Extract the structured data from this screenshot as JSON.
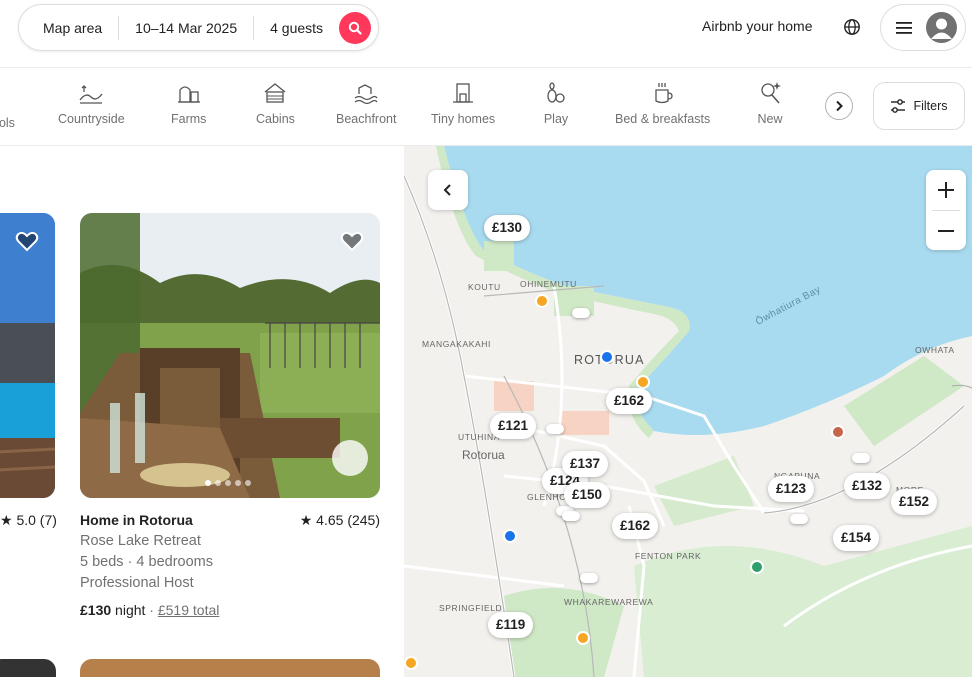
{
  "header": {
    "search": {
      "where": "Map area",
      "dates": "10–14 Mar 2025",
      "guests": "4 guests"
    },
    "host_link": "Airbnb your home",
    "brand_color": "#ff385c"
  },
  "categories": {
    "items": [
      {
        "label": "ools",
        "icon": "pools-icon"
      },
      {
        "label": "Countryside",
        "icon": "countryside-icon"
      },
      {
        "label": "Farms",
        "icon": "farms-icon"
      },
      {
        "label": "Cabins",
        "icon": "cabins-icon"
      },
      {
        "label": "Beachfront",
        "icon": "beachfront-icon"
      },
      {
        "label": "Tiny homes",
        "icon": "tiny-homes-icon"
      },
      {
        "label": "Play",
        "icon": "play-icon"
      },
      {
        "label": "Bed & breakfasts",
        "icon": "bed-breakfast-icon"
      },
      {
        "label": "New",
        "icon": "new-icon"
      }
    ],
    "filters_label": "Filters"
  },
  "listings": {
    "left_rating": "★ 5.0 (7)",
    "main": {
      "title": "Home in Rotorua",
      "rating": "★ 4.65 (245)",
      "name": "Rose Lake Retreat",
      "beds": "5 beds · 4 bedrooms",
      "host": "Professional Host",
      "price": "£130",
      "price_unit": " night",
      "separator": " · ",
      "total": "£519 total"
    }
  },
  "map": {
    "pins": [
      "£130",
      "£162",
      "£121",
      "£137",
      "£124",
      "£150",
      "£162",
      "£123",
      "£132",
      "£152",
      "£154",
      "£119"
    ],
    "labels": {
      "koutu": "KOUTU",
      "ohinemutu": "OHINEMUTU",
      "mangakakahi": "MANGAKAKAHI",
      "rotorua_caps": "ROTORUA",
      "utuhina": "UTUHINA",
      "rotorua": "Rotorua",
      "glenholme": "GLENHO",
      "fenton_park": "FENTON PARK",
      "ngapuna": "NGAPUNA",
      "owhata": "OWHATA",
      "springfield": "SPRINGFIELD",
      "whakarewarewa": "WHAKAREWAREWA",
      "bay": "Ōwhatiura Bay",
      "more": "MORE"
    }
  }
}
